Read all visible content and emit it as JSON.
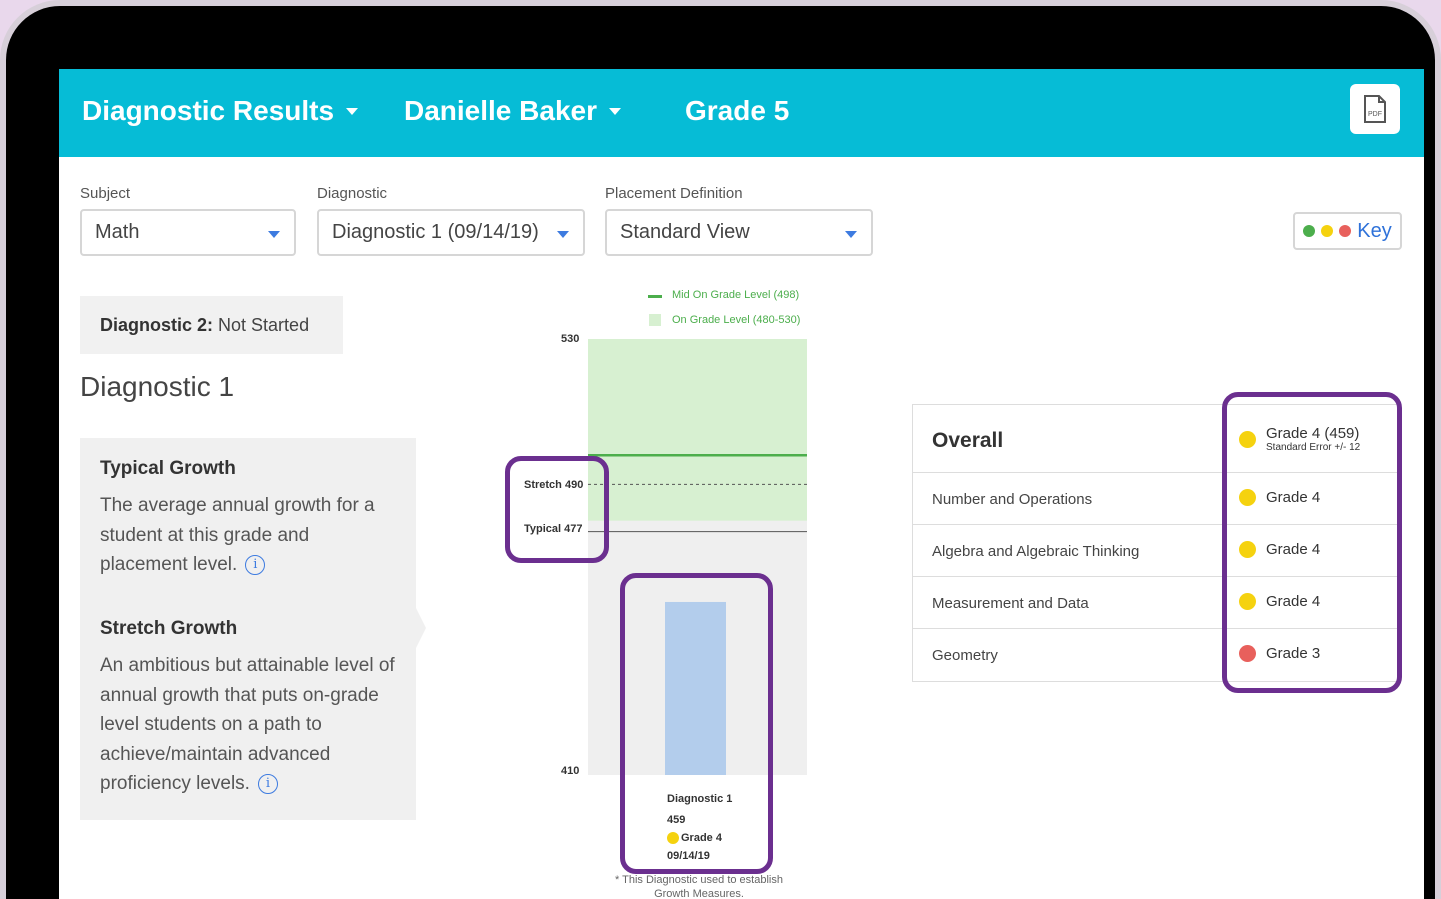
{
  "header": {
    "report_label": "Diagnostic Results",
    "student_name": "Danielle Baker",
    "grade_label": "Grade 5",
    "pdf_icon_text": "PDF"
  },
  "filters": {
    "subject": {
      "label": "Subject",
      "value": "Math"
    },
    "diagnostic": {
      "label": "Diagnostic",
      "value": "Diagnostic 1 (09/14/19)"
    },
    "placement": {
      "label": "Placement Definition",
      "value": "Standard View"
    },
    "key_label": "Key"
  },
  "status": {
    "diag2_prefix": "Diagnostic 2:",
    "diag2_value": " Not Started",
    "diag1_title": "Diagnostic 1"
  },
  "growth": {
    "typical_title": "Typical Growth",
    "typical_text": "The average annual growth for a student at this grade and placement level.",
    "stretch_title": "Stretch Growth",
    "stretch_text": "An ambitious but attainable level of annual growth that puts on-grade level students on a path to achieve/maintain advanced proficiency levels."
  },
  "chart": {
    "legend_mid": "Mid On Grade Level (498)",
    "legend_on": "On Grade Level (480-530)",
    "y_max_label": "530",
    "y_min_label": "410",
    "stretch_label": "Stretch 490",
    "typical_label": "Typical 477",
    "bar_title": "Diagnostic 1",
    "bar_score": "459",
    "bar_grade": "Grade 4",
    "bar_date": "09/14/19",
    "footnote": "* This Diagnostic used to establish Growth Measures."
  },
  "chart_data": {
    "type": "bar",
    "categories": [
      "Diagnostic 1"
    ],
    "values": [
      459
    ],
    "ylim": [
      410,
      530
    ],
    "reference_lines": [
      {
        "name": "Mid On Grade Level (498)",
        "value": 498
      },
      {
        "name": "Stretch 490",
        "value": 490
      },
      {
        "name": "Typical 477",
        "value": 477
      }
    ],
    "band": {
      "name": "On Grade Level (480-530)",
      "from": 480,
      "to": 530
    }
  },
  "domains": {
    "overall_label": "Overall",
    "overall_value": "Grade 4 (459)",
    "overall_sub": "Standard Error +/- 12",
    "rows": [
      {
        "label": "Number and Operations",
        "value": "Grade 4",
        "color": "#f5d20f"
      },
      {
        "label": "Algebra and Algebraic Thinking",
        "value": "Grade 4",
        "color": "#f5d20f"
      },
      {
        "label": "Measurement and Data",
        "value": "Grade 4",
        "color": "#f5d20f"
      },
      {
        "label": "Geometry",
        "value": "Grade 3",
        "color": "#e8605c"
      }
    ]
  },
  "colors": {
    "header": "#06bcd6",
    "highlight": "#6b2f8f",
    "on_level": "#f5d20f",
    "below": "#e8605c",
    "above": "#4cae4c"
  }
}
